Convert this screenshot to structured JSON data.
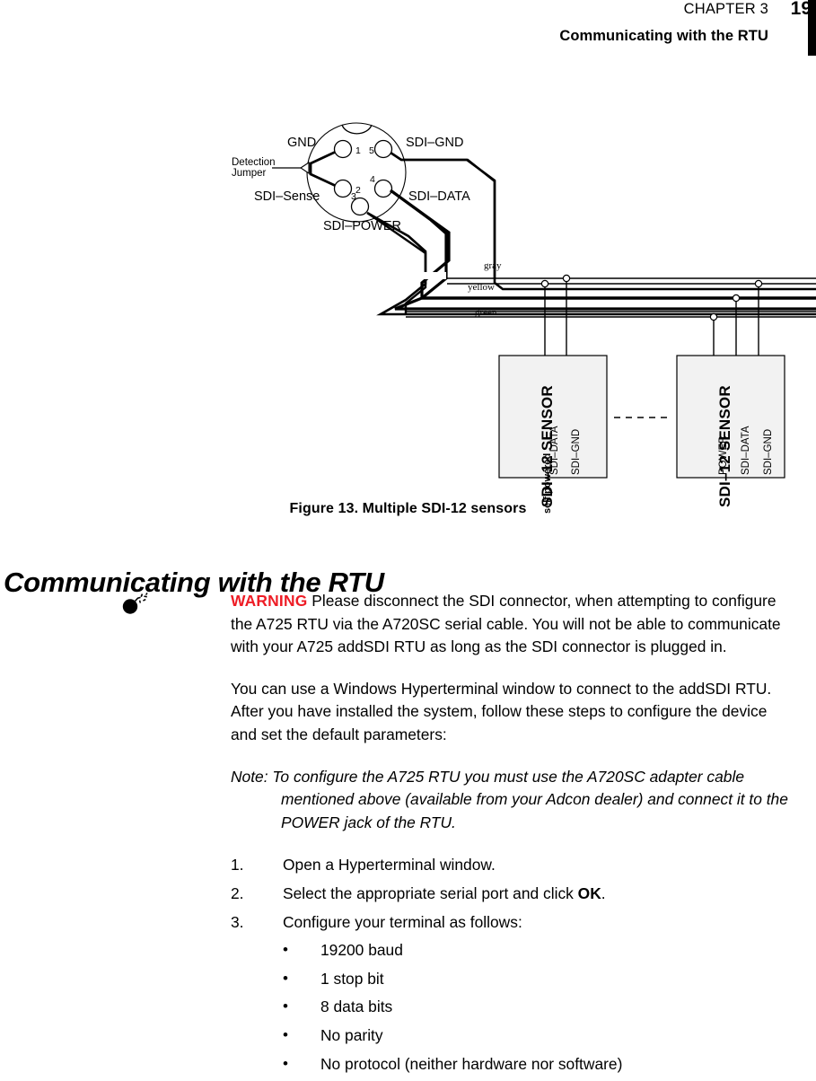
{
  "header": {
    "chapter": "CHAPTER 3",
    "page_number": "19",
    "running_title": "Communicating with the RTU"
  },
  "figure": {
    "caption": "Figure 13.  Multiple SDI-12 sensors",
    "connector": {
      "pins": [
        "1",
        "2",
        "3",
        "4",
        "5"
      ],
      "labels": {
        "gnd": "GND",
        "sdi_gnd": "SDI–GND",
        "sdi_sense": "SDI–Sense",
        "sdi_data": "SDI–DATA",
        "sdi_power": "SDI–POWER",
        "detection_jumper_line1": "Detection",
        "detection_jumper_line2": "Jumper"
      }
    },
    "wires": {
      "gray": "gray",
      "yellow": "yellow",
      "green": "green"
    },
    "sensor_left": {
      "title": "SDI–12 SENSOR",
      "subtitle": "self powered",
      "terminals": [
        "SDI–DATA",
        "SDI–GND"
      ]
    },
    "sensor_right": {
      "title": "SDI–12 SENSOR",
      "subtitle": "",
      "terminals": [
        "POWER",
        "SDI–DATA",
        "SDI–GND"
      ]
    }
  },
  "section": {
    "heading": "Communicating with the RTU"
  },
  "warning": {
    "icon": "bomb-icon",
    "label": "WARNING",
    "text": " Please disconnect the SDI connector, when attempting to configure the A725 RTU via the A720SC serial cable. You will not be able to communicate with your A725 addSDI RTU as long as the SDI connector is plugged in."
  },
  "paragraphs": {
    "intro": "You can use a Windows Hyperterminal window to connect to the addSDI RTU. After you have installed the system, follow these steps to configure the device and set the default parameters:"
  },
  "note": {
    "label": "Note:",
    "text": " To configure the A725 RTU you must use the A720SC adapter cable mentioned above (available from your Adcon dealer) and connect it to the POWER jack of the RTU."
  },
  "steps": [
    {
      "num": "1.",
      "text": "Open a Hyperterminal window.",
      "bold_tail": ""
    },
    {
      "num": "2.",
      "text": "Select the appropriate serial port and click ",
      "bold_tail": "OK",
      "tail": "."
    },
    {
      "num": "3.",
      "text": "Configure your terminal as follows:",
      "bold_tail": ""
    }
  ],
  "options": [
    {
      "bullet": "•",
      "text": "19200 baud"
    },
    {
      "bullet": "•",
      "text": "1 stop bit"
    },
    {
      "bullet": "•",
      "text": "8 data bits"
    },
    {
      "bullet": "•",
      "text": "No parity"
    },
    {
      "bullet": "•",
      "text": "No protocol (neither hardware nor software)"
    }
  ],
  "colors": {
    "warning_red": "#ee1c25",
    "sensor_box_fill": "#f2f2f2",
    "ink": "#000000"
  }
}
